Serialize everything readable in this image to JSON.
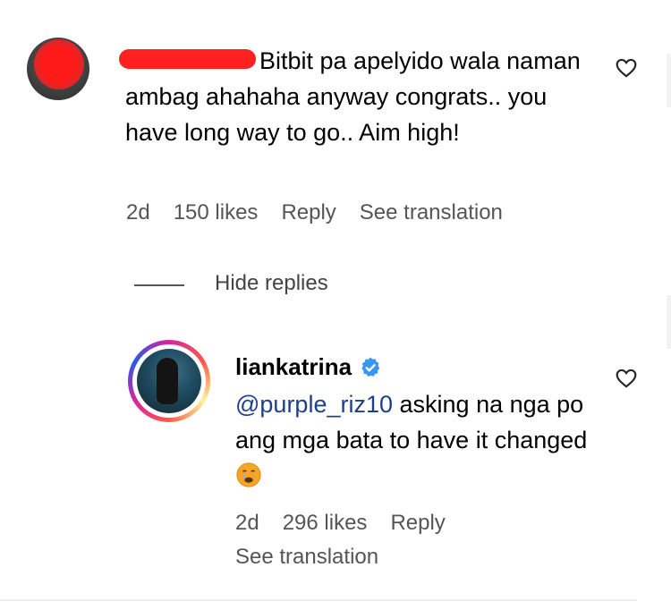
{
  "comment": {
    "text": "Bitbit pa apelyido wala naman ambag ahahaha anyway congrats.. you have long way to go.. Aim high!",
    "meta": {
      "time": "2d",
      "likes": "150 likes",
      "reply": "Reply",
      "see_translation": "See translation"
    }
  },
  "hide_replies": "Hide replies",
  "reply": {
    "username": "liankatrina",
    "mention": "@purple_riz10",
    "text": " asking na nga po ang mga bata to have it changed ",
    "meta": {
      "time": "2d",
      "likes": "296 likes",
      "reply": "Reply",
      "see_translation": "See translation"
    }
  },
  "colors": {
    "verified": "#3897f0",
    "mention": "#1e3f8a",
    "redaction": "#ff2020"
  },
  "icons": [
    "heart-outline-icon",
    "verified-badge-icon",
    "crying-emoji-icon"
  ]
}
